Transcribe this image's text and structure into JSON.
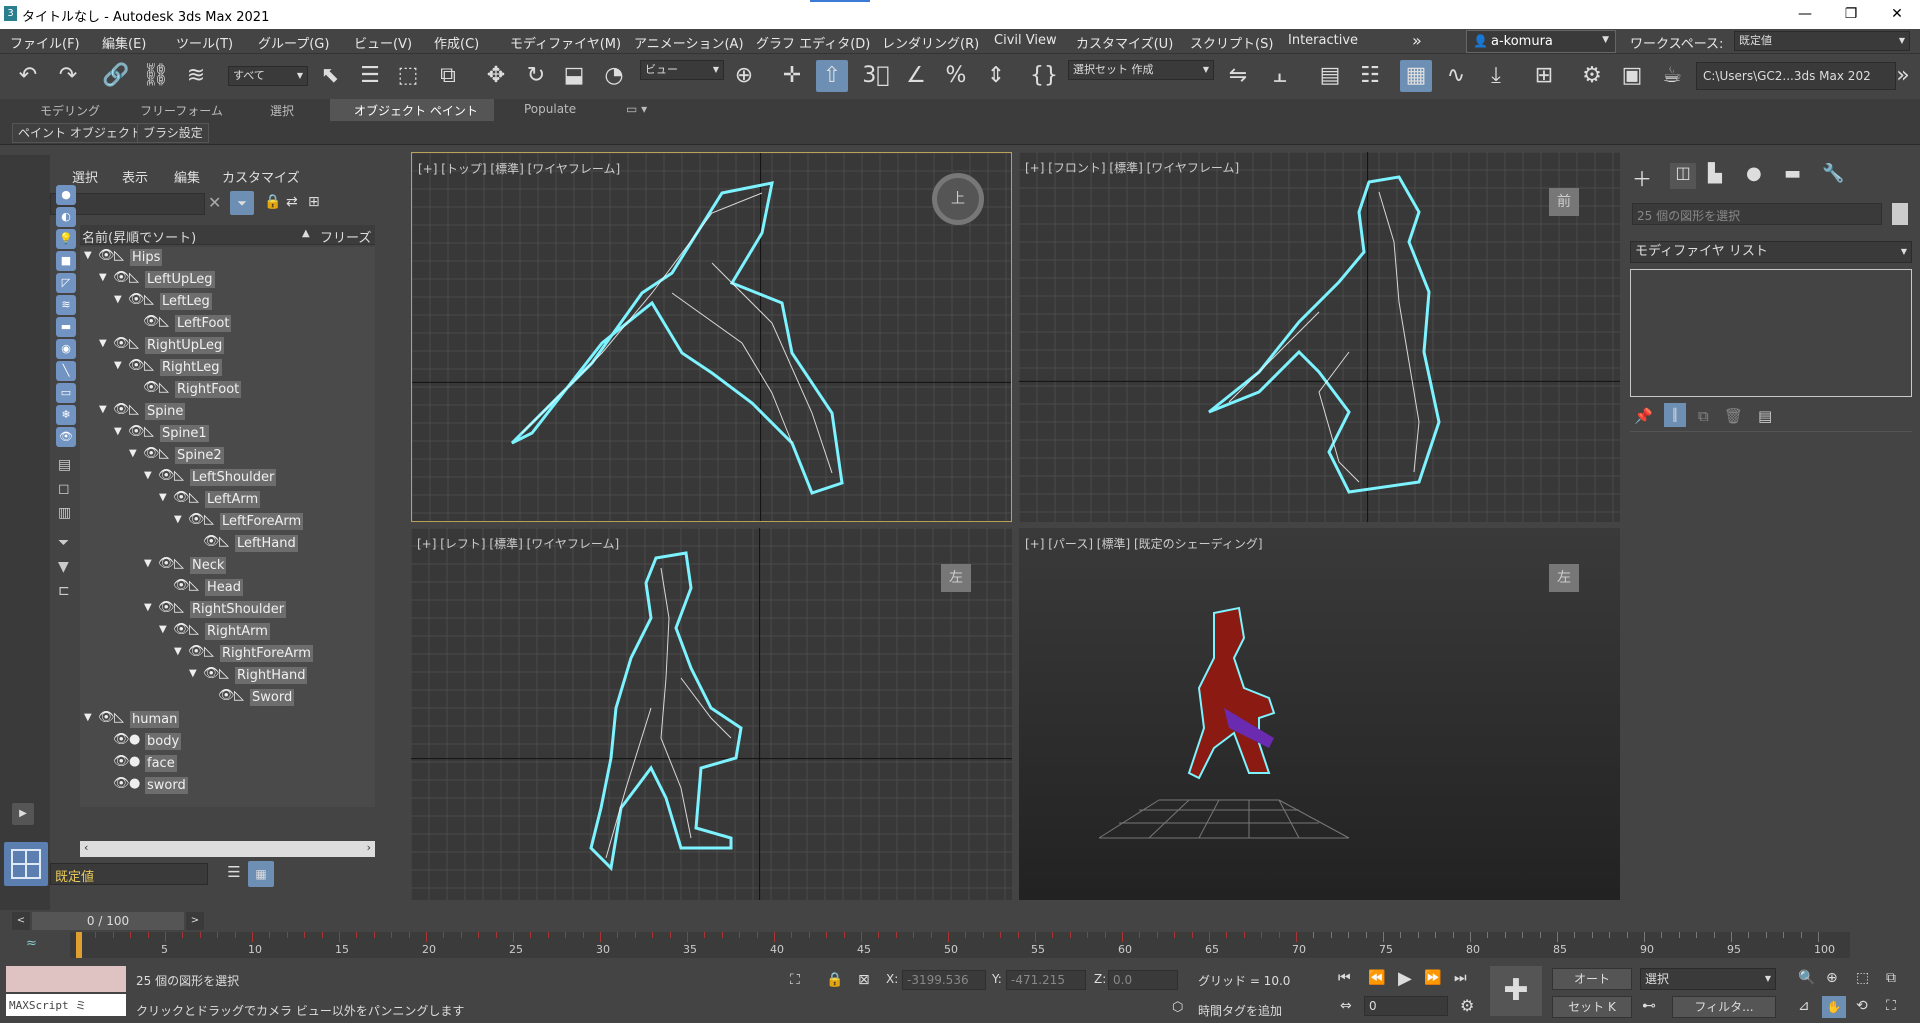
{
  "app": {
    "title": "タイトルなし - Autodesk 3ds Max 2021",
    "icon": "3"
  },
  "menu": [
    "ファイル(F)",
    "編集(E)",
    "ツール(T)",
    "グループ(G)",
    "ビュー(V)",
    "作成(C)",
    "モディファイヤ(M)",
    "アニメーション(A)",
    "グラフ エディタ(D)",
    "レンダリング(R)",
    "Civil View",
    "カスタマイズ(U)",
    "スクリプト(S)",
    "Interactive"
  ],
  "user": "a-komura",
  "workspace": {
    "label": "ワークスペース:",
    "value": "既定値"
  },
  "toolbar": {
    "selection_filter": "すべて",
    "ref_coord": "ビュー",
    "named_sel": "選択セット 作成",
    "path": "C:\\Users\\GC2...3ds Max 202"
  },
  "ribbon": {
    "tabs": [
      "モデリング",
      "フリーフォーム",
      "選択",
      "オブジェクト ペイント",
      "Populate"
    ],
    "sub": [
      "ペイント オブジェクト",
      "ブラシ設定"
    ]
  },
  "scene": {
    "menu": [
      "選択",
      "表示",
      "編集",
      "カスタマイズ"
    ],
    "col_name": "名前(昇順でソート)",
    "col_freeze": "フリーズ",
    "rows": [
      {
        "name": "Hips",
        "depth": 0
      },
      {
        "name": "LeftUpLeg",
        "depth": 1
      },
      {
        "name": "LeftLeg",
        "depth": 2
      },
      {
        "name": "LeftFoot",
        "depth": 3
      },
      {
        "name": "RightUpLeg",
        "depth": 1
      },
      {
        "name": "RightLeg",
        "depth": 2
      },
      {
        "name": "RightFoot",
        "depth": 3
      },
      {
        "name": "Spine",
        "depth": 1
      },
      {
        "name": "Spine1",
        "depth": 2
      },
      {
        "name": "Spine2",
        "depth": 3
      },
      {
        "name": "LeftShoulder",
        "depth": 4
      },
      {
        "name": "LeftArm",
        "depth": 5
      },
      {
        "name": "LeftForeArm",
        "depth": 6
      },
      {
        "name": "LeftHand",
        "depth": 7
      },
      {
        "name": "Neck",
        "depth": 4
      },
      {
        "name": "Head",
        "depth": 5
      },
      {
        "name": "RightShoulder",
        "depth": 4
      },
      {
        "name": "RightArm",
        "depth": 5
      },
      {
        "name": "RightForeArm",
        "depth": 6
      },
      {
        "name": "RightHand",
        "depth": 7
      },
      {
        "name": "Sword",
        "depth": 8
      },
      {
        "name": "human",
        "depth": 0
      },
      {
        "name": "body",
        "depth": 1
      },
      {
        "name": "face",
        "depth": 1
      },
      {
        "name": "sword",
        "depth": 1
      }
    ],
    "layer": "既定値"
  },
  "viewports": {
    "top": "[+] [トップ] [標準] [ワイヤフレーム]",
    "front": "[+] [フロント] [標準] [ワイヤフレーム]",
    "left": "[+] [レフト] [標準] [ワイヤフレーム]",
    "persp": "[+] [パース] [標準] [既定のシェーディング]",
    "cube_top": "上",
    "cube_front": "前",
    "cube_left": "左",
    "cube_persp": "左"
  },
  "command": {
    "sel_count": "25 個の図形を選択",
    "modlist": "モディファイヤ リスト"
  },
  "timeline": {
    "frame": "0 / 100",
    "ticks": [
      "5",
      "10",
      "15",
      "20",
      "25",
      "30",
      "35",
      "40",
      "45",
      "50",
      "55",
      "60",
      "65",
      "70",
      "75",
      "80",
      "85",
      "90",
      "95",
      "100"
    ]
  },
  "status": {
    "selected": "25 個の図形を選択",
    "hint": "クリックとドラッグでカメラ ビュー以外をパンニングします",
    "maxscript": "MAXScript ミ",
    "x": "-3199.536",
    "y": "-471.215",
    "z": "0.0",
    "grid": "グリッド = 10.0",
    "timetag": "時間タグを追加",
    "auto": "オート",
    "setkey": "セット K",
    "sel_mode": "選択",
    "frame_field": "0",
    "filter": "フィルタ..."
  }
}
